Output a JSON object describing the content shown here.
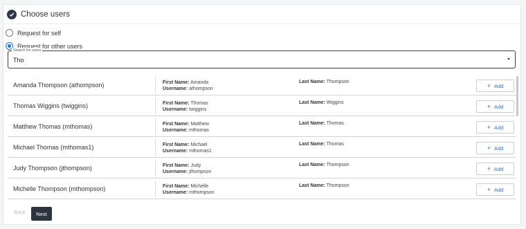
{
  "header": {
    "title": "Choose users"
  },
  "request_options": [
    {
      "label": "Request for self",
      "checked": false
    },
    {
      "label": "Request for other users",
      "checked": true
    }
  ],
  "search": {
    "legend": "Search for users",
    "value": "Tho"
  },
  "field_labels": {
    "first_name": "First Name:",
    "username": "Username:",
    "last_name": "Last Name:"
  },
  "add_label": "Add",
  "results": [
    {
      "display": "Amanda Thompson (athompson)",
      "first_name": "Amanda",
      "username": "athompson",
      "last_name": "Thompson"
    },
    {
      "display": "Thomas Wiggins (twiggins)",
      "first_name": "Thomas",
      "username": "twiggins",
      "last_name": "Wiggins"
    },
    {
      "display": "Matthew Thomas (mthomas)",
      "first_name": "Matthew",
      "username": "mthomas",
      "last_name": "Thomas"
    },
    {
      "display": "Michael Thomas (mthomas1)",
      "first_name": "Michael",
      "username": "mthomas1",
      "last_name": "Thomas"
    },
    {
      "display": "Judy Thompson (jthompson)",
      "first_name": "Judy",
      "username": "jthompson",
      "last_name": "Thompson"
    },
    {
      "display": "Michelle Thompson (mthompson)",
      "first_name": "Michelle",
      "username": "mthompson",
      "last_name": "Thompson"
    }
  ],
  "footer": {
    "back_label": "Back",
    "next_label": "Next"
  }
}
